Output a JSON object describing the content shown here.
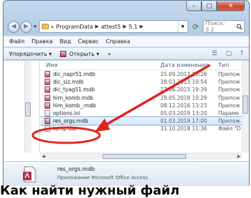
{
  "address": {
    "crumbs": [
      "«",
      "ProgramData",
      "attest5",
      "5.1"
    ],
    "search_placeholder": "Поиск: 5.1"
  },
  "menu": [
    "Файл",
    "Правка",
    "Вид",
    "Сервис",
    "Справка"
  ],
  "toolbar": {
    "organize": "Упорядочить ▾",
    "open": "Открыть ▾",
    "more": "»"
  },
  "columns": {
    "name": "Имя",
    "date": "Дата изменения",
    "type": "Тип"
  },
  "files": [
    {
      "name": "dic_napr51.mdb",
      "date": "15.09.2017 16:26",
      "type": "Прилож",
      "icon": "access-file-icon"
    },
    {
      "name": "dic_siz.mdb",
      "date": "28.03.2013 10:54",
      "type": "Прилож",
      "icon": "access-file-icon"
    },
    {
      "name": "dic_tyag51.mdb",
      "date": "27.06.2015 19:39",
      "type": "Прилож",
      "icon": "access-file-icon"
    },
    {
      "name": "him_komb.mdb",
      "date": "28.05.2018 10:29",
      "type": "Прилож",
      "icon": "access-file-icon"
    },
    {
      "name": "him_komb_.mdb",
      "date": "08.12.2016 13:23",
      "type": "Прилож",
      "icon": "access-file-icon"
    },
    {
      "name": "options.ini",
      "date": "05.03.2019 13:20",
      "type": "Параме",
      "icon": "ini-file-icon"
    },
    {
      "name": "res_orgs.mdb",
      "date": "01.03.2019 17:00",
      "type": "Прилож",
      "icon": "access-file-icon",
      "selected": true
    },
    {
      "name": "temp.dat",
      "date": "31.10.2018 11:36",
      "type": "Файл \"D",
      "icon": "ini-file-icon"
    }
  ],
  "details": {
    "name": "res_orgs.mdb",
    "type": "Приложение Microsoft Office Access"
  },
  "caption": "Как найти нужный файл",
  "colors": {
    "arrow": "#e0231b",
    "selection": "#d2e6fb"
  }
}
